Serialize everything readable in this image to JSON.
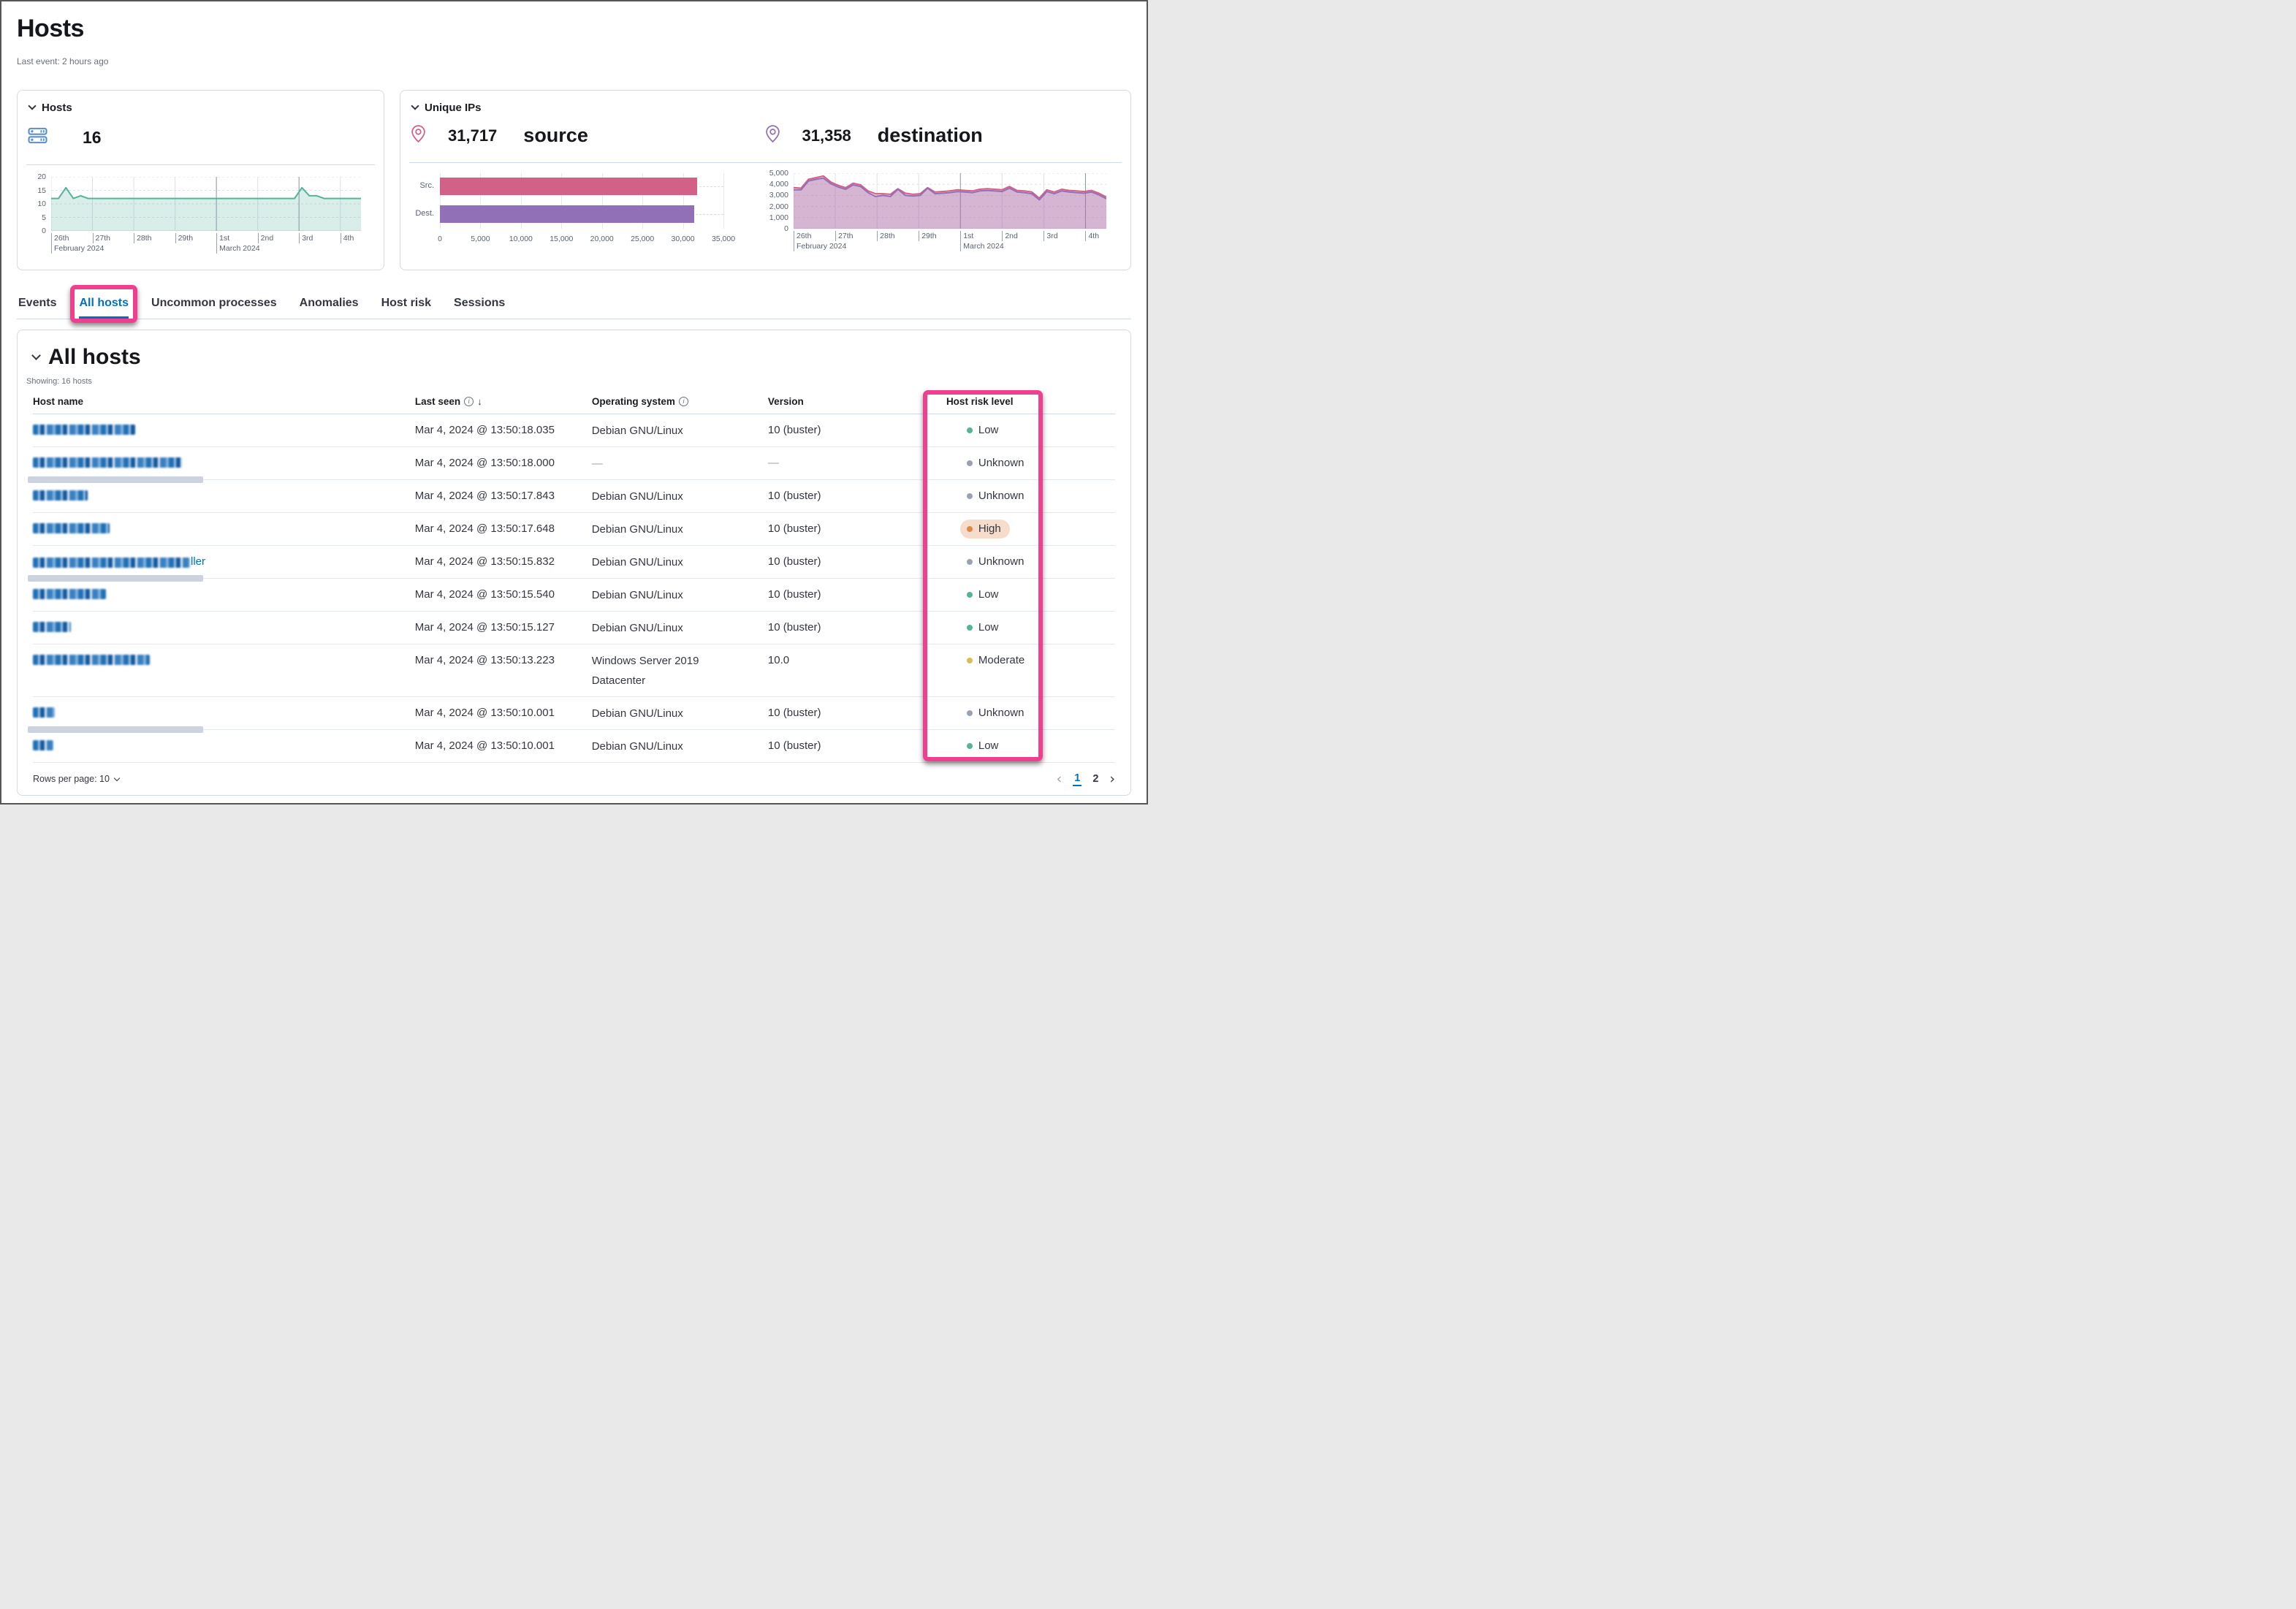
{
  "page": {
    "title": "Hosts",
    "subtitle": "Last event: 2 hours ago"
  },
  "kpi_hosts": {
    "title": "Hosts",
    "value": "16",
    "icon": "storage-icon"
  },
  "kpi_ips": {
    "title": "Unique IPs",
    "source": {
      "value": "31,717",
      "label": "source",
      "icon": "map-pin-icon"
    },
    "destination": {
      "value": "31,358",
      "label": "destination",
      "icon": "map-pin-icon"
    }
  },
  "tabs": [
    {
      "label": "Events",
      "active": false,
      "annotated": false
    },
    {
      "label": "All hosts",
      "active": true,
      "annotated": true
    },
    {
      "label": "Uncommon processes",
      "active": false,
      "annotated": false
    },
    {
      "label": "Anomalies",
      "active": false,
      "annotated": false
    },
    {
      "label": "Host risk",
      "active": false,
      "annotated": false
    },
    {
      "label": "Sessions",
      "active": false,
      "annotated": false
    }
  ],
  "table": {
    "title": "All hosts",
    "showing": "Showing: 16 hosts",
    "columns": [
      {
        "label": "Host name",
        "info_icon": false,
        "sort": "",
        "annotated": false
      },
      {
        "label": "Last seen",
        "info_icon": true,
        "sort": "down",
        "annotated": false
      },
      {
        "label": "Operating system",
        "info_icon": true,
        "sort": "",
        "annotated": false
      },
      {
        "label": "Version",
        "info_icon": false,
        "sort": "",
        "annotated": false
      },
      {
        "label": "Host risk level",
        "info_icon": false,
        "sort": "",
        "annotated": true
      }
    ],
    "rows": [
      {
        "host_redacted_width": 140,
        "host_suffix": "",
        "last_seen": "Mar 4, 2024 @ 13:50:18.035",
        "os": "Debian GNU/Linux",
        "version": "10 (buster)",
        "risk": "Low",
        "censor_bar": false
      },
      {
        "host_redacted_width": 205,
        "host_suffix": "",
        "last_seen": "Mar 4, 2024 @ 13:50:18.000",
        "os": "—",
        "version": "—",
        "risk": "Unknown",
        "censor_bar": true
      },
      {
        "host_redacted_width": 75,
        "host_suffix": "",
        "last_seen": "Mar 4, 2024 @ 13:50:17.843",
        "os": "Debian GNU/Linux",
        "version": "10 (buster)",
        "risk": "Unknown",
        "censor_bar": false
      },
      {
        "host_redacted_width": 105,
        "host_suffix": "",
        "last_seen": "Mar 4, 2024 @ 13:50:17.648",
        "os": "Debian GNU/Linux",
        "version": "10 (buster)",
        "risk": "High",
        "censor_bar": false
      },
      {
        "host_redacted_width": 215,
        "host_suffix": "ller",
        "last_seen": "Mar 4, 2024 @ 13:50:15.832",
        "os": "Debian GNU/Linux",
        "version": "10 (buster)",
        "risk": "Unknown",
        "censor_bar": true
      },
      {
        "host_redacted_width": 100,
        "host_suffix": "",
        "last_seen": "Mar 4, 2024 @ 13:50:15.540",
        "os": "Debian GNU/Linux",
        "version": "10 (buster)",
        "risk": "Low",
        "censor_bar": false
      },
      {
        "host_redacted_width": 52,
        "host_suffix": "",
        "last_seen": "Mar 4, 2024 @ 13:50:15.127",
        "os": "Debian GNU/Linux",
        "version": "10 (buster)",
        "risk": "Low",
        "censor_bar": false
      },
      {
        "host_redacted_width": 160,
        "host_suffix": "",
        "last_seen": "Mar 4, 2024 @ 13:50:13.223",
        "os": "Windows Server 2019 Datacenter",
        "version": "10.0",
        "risk": "Moderate",
        "censor_bar": false
      },
      {
        "host_redacted_width": 30,
        "host_suffix": "",
        "last_seen": "Mar 4, 2024 @ 13:50:10.001",
        "os": "Debian GNU/Linux",
        "version": "10 (buster)",
        "risk": "Unknown",
        "censor_bar": true
      },
      {
        "host_redacted_width": 28,
        "host_suffix": "",
        "last_seen": "Mar 4, 2024 @ 13:50:10.001",
        "os": "Debian GNU/Linux",
        "version": "10 (buster)",
        "risk": "Low",
        "censor_bar": false
      }
    ]
  },
  "pagination": {
    "rows_per_page_label": "Rows per page: 10",
    "pages": [
      "1",
      "2"
    ],
    "active_page": "1",
    "prev_icon": "chevron-left-icon",
    "next_icon": "chevron-right-icon"
  },
  "colors": {
    "annotation_pink": "#ef3f8e",
    "link_blue": "#0071c2",
    "hosts_green": "#54b399",
    "source_pink": "#d36086",
    "destination_purple": "#9170b8",
    "high_pill_bg": "#f6dcca",
    "risk": {
      "Low": "#54b399",
      "Unknown": "#98a2b3",
      "Moderate": "#d6bf57",
      "High": "#da8b45"
    }
  },
  "chart_data": [
    {
      "id": "hosts_over_time",
      "type": "area",
      "title": "Hosts over time",
      "ylim": [
        0,
        20
      ],
      "yticks": [
        0,
        5,
        10,
        15,
        20
      ],
      "xticks": [
        {
          "label": "26th",
          "sub": "February 2024",
          "frac": 0.0,
          "major": false
        },
        {
          "label": "27th",
          "sub": "",
          "frac": 0.1333,
          "major": false
        },
        {
          "label": "28th",
          "sub": "",
          "frac": 0.2667,
          "major": false
        },
        {
          "label": "29th",
          "sub": "",
          "frac": 0.4,
          "major": false
        },
        {
          "label": "1st",
          "sub": "March 2024",
          "frac": 0.5333,
          "major": true
        },
        {
          "label": "2nd",
          "sub": "",
          "frac": 0.6667,
          "major": false
        },
        {
          "label": "3rd",
          "sub": "",
          "frac": 0.8,
          "major": true
        },
        {
          "label": "4th",
          "sub": "",
          "frac": 0.9333,
          "major": false
        }
      ],
      "series": [
        {
          "name": "hosts",
          "color": "#54b399",
          "fill": "rgba(84,179,153,0.22)",
          "values": [
            12,
            12,
            16,
            12,
            13,
            12,
            12,
            12,
            12,
            12,
            12,
            12,
            12,
            12,
            12,
            12,
            12,
            12,
            12,
            12,
            12,
            12,
            12,
            12,
            12,
            12,
            12,
            12,
            12,
            12,
            12,
            12,
            12,
            12,
            16,
            13,
            13,
            12,
            12,
            12,
            12,
            12,
            12
          ]
        }
      ]
    },
    {
      "id": "unique_ips_bar",
      "type": "bar",
      "orientation": "horizontal",
      "categories": [
        "Src.",
        "Dest."
      ],
      "values": [
        31717,
        31358
      ],
      "colors": [
        "#d36086",
        "#9170b8"
      ],
      "xlim": [
        0,
        35000
      ],
      "xticks": [
        0,
        5000,
        10000,
        15000,
        20000,
        25000,
        30000,
        35000
      ]
    },
    {
      "id": "unique_ips_over_time",
      "type": "area",
      "title": "Unique IPs over time",
      "ylim": [
        0,
        5000
      ],
      "yticks": [
        0,
        1000,
        2000,
        3000,
        4000,
        5000
      ],
      "xticks": [
        {
          "label": "26th",
          "sub": "February 2024",
          "frac": 0.0,
          "major": false
        },
        {
          "label": "27th",
          "sub": "",
          "frac": 0.1333,
          "major": false
        },
        {
          "label": "28th",
          "sub": "",
          "frac": 0.2667,
          "major": false
        },
        {
          "label": "29th",
          "sub": "",
          "frac": 0.4,
          "major": false
        },
        {
          "label": "1st",
          "sub": "March 2024",
          "frac": 0.5333,
          "major": true
        },
        {
          "label": "2nd",
          "sub": "",
          "frac": 0.6667,
          "major": false
        },
        {
          "label": "3rd",
          "sub": "",
          "frac": 0.8,
          "major": false
        },
        {
          "label": "4th",
          "sub": "",
          "frac": 0.9333,
          "major": true
        }
      ],
      "series": [
        {
          "name": "source",
          "color": "#d36086",
          "fill": "rgba(211,96,134,0.28)",
          "values": [
            3700,
            3650,
            4450,
            4600,
            4750,
            4200,
            3900,
            3700,
            4100,
            3950,
            3400,
            3150,
            3150,
            3100,
            3600,
            3200,
            3100,
            3150,
            3700,
            3300,
            3350,
            3400,
            3500,
            3450,
            3400,
            3550,
            3600,
            3550,
            3500,
            3800,
            3450,
            3400,
            3300,
            2750,
            3500,
            3300,
            3550,
            3450,
            3400,
            3350,
            3450,
            3200,
            2850
          ]
        },
        {
          "name": "destination",
          "color": "#9170b8",
          "fill": "rgba(145,112,184,0.30)",
          "values": [
            3500,
            3500,
            4300,
            4450,
            4550,
            4050,
            3750,
            3550,
            3950,
            3800,
            3250,
            2900,
            3000,
            2900,
            3550,
            3000,
            2950,
            3000,
            3650,
            3150,
            3200,
            3250,
            3350,
            3300,
            3250,
            3400,
            3450,
            3400,
            3350,
            3650,
            3300,
            3250,
            3150,
            2600,
            3350,
            3150,
            3400,
            3300,
            3250,
            3200,
            3300,
            3050,
            2700
          ]
        }
      ]
    }
  ]
}
